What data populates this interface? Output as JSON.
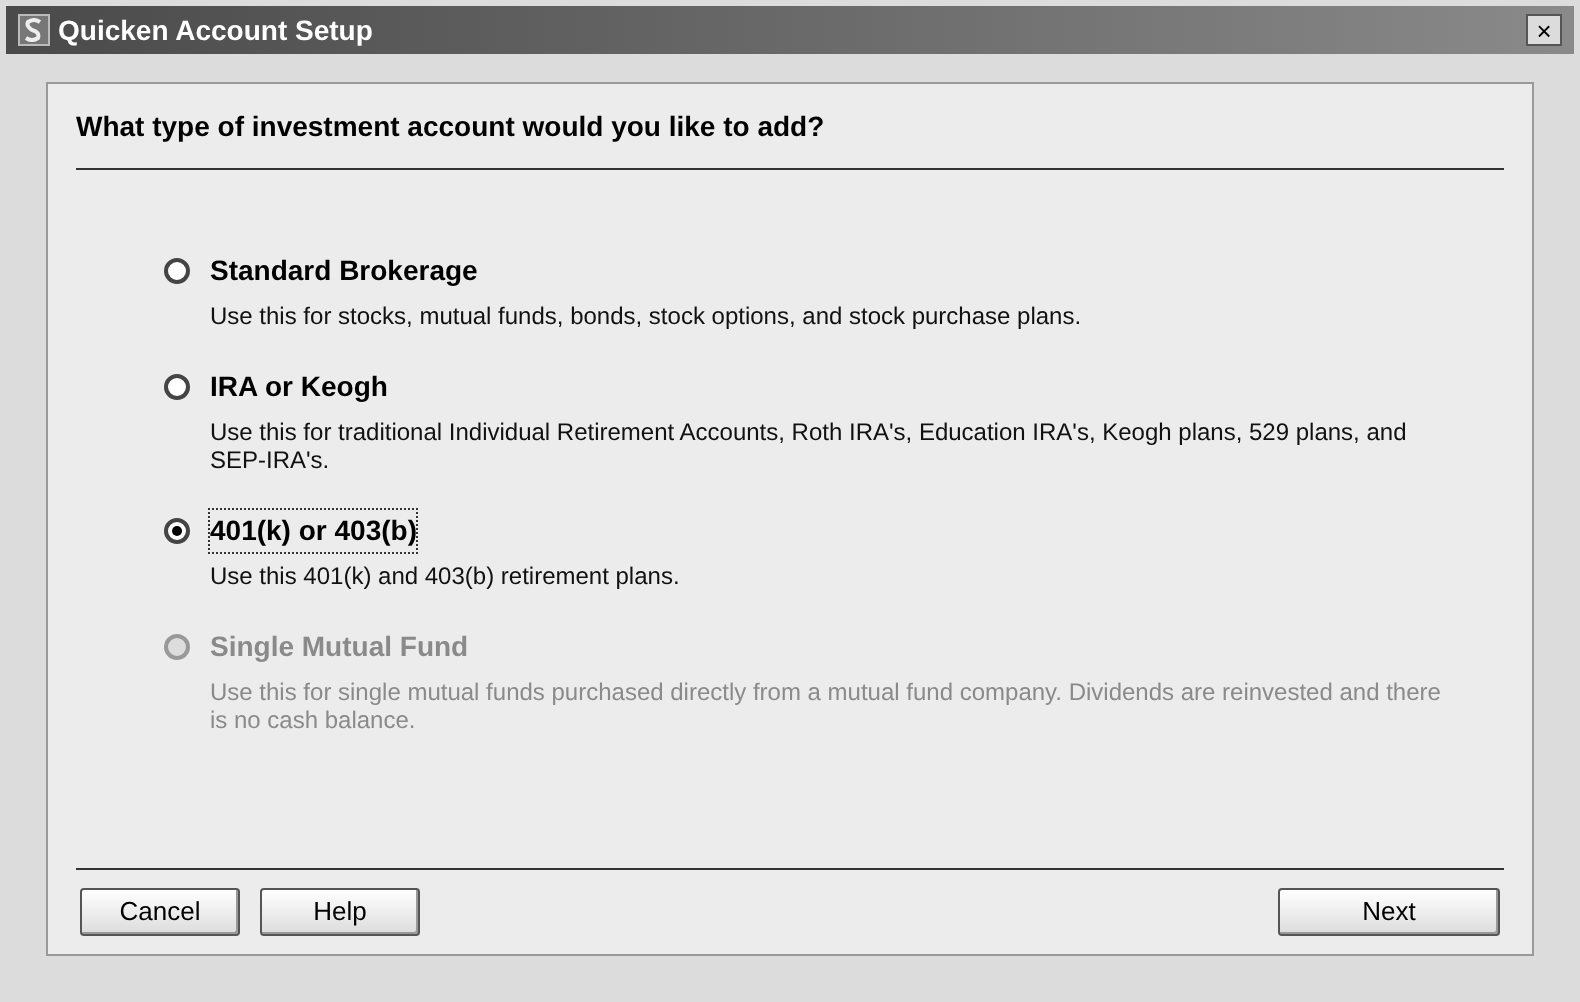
{
  "window": {
    "title": "Quicken Account Setup",
    "close": "×"
  },
  "heading": "What type of investment account would you like to add?",
  "options": [
    {
      "label": "Standard Brokerage",
      "description": "Use this for stocks, mutual funds, bonds, stock options, and stock purchase plans.",
      "selected": false,
      "disabled": false
    },
    {
      "label": "IRA or Keogh",
      "description": "Use this for traditional Individual Retirement Accounts, Roth IRA's, Education IRA's, Keogh plans, 529 plans, and SEP-IRA's.",
      "selected": false,
      "disabled": false
    },
    {
      "label": "401(k) or 403(b)",
      "description": "Use this 401(k) and 403(b) retirement plans.",
      "selected": true,
      "disabled": false
    },
    {
      "label": "Single Mutual Fund",
      "description": "Use this for single mutual funds purchased directly from a mutual fund company. Dividends are reinvested and there is no cash balance.",
      "selected": false,
      "disabled": true
    }
  ],
  "buttons_left": [
    "Cancel",
    "Help"
  ],
  "buttons_right": [
    "Next"
  ]
}
